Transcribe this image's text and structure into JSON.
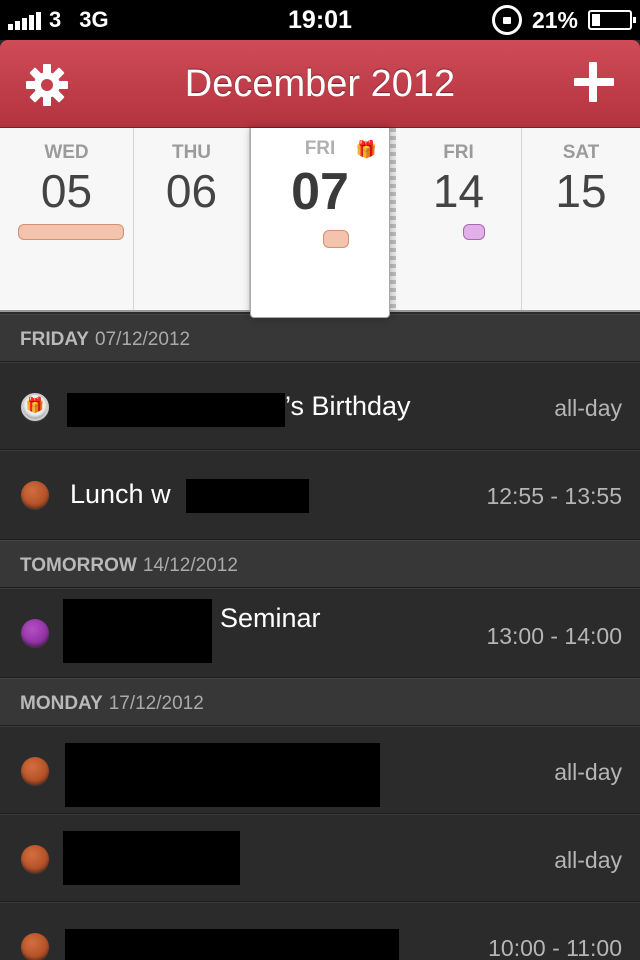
{
  "status_bar": {
    "carrier": "3",
    "network": "3G",
    "time": "19:01",
    "battery": "21%"
  },
  "header": {
    "title": "December 2012"
  },
  "icons": {
    "settings": "gear-icon",
    "add": "plus-icon",
    "birthday": "gift-icon"
  },
  "colors": {
    "header_red": "#c23f4b",
    "orange_calendar": "#b84e23",
    "purple_calendar": "#9a33ac",
    "orange_pill": "#f4c3ad",
    "purple_pill": "#e2b0e8"
  },
  "week": {
    "days": [
      {
        "name": "WED",
        "num": "05"
      },
      {
        "name": "THU",
        "num": "06"
      },
      {
        "name": "FRI",
        "num": "07",
        "selected": true
      },
      {
        "name": "FRI",
        "num": "14"
      },
      {
        "name": "SAT",
        "num": "15"
      }
    ],
    "gift_glyph": "🎁"
  },
  "sections": [
    {
      "day": "FRIDAY",
      "date": "07/12/2012",
      "events": [
        {
          "title": "’s Birthday",
          "time": "all-day",
          "calendar": "birthday",
          "glyph": "🎁"
        },
        {
          "title": "Lunch w",
          "time": "12:55 - 13:55",
          "calendar": "orange"
        }
      ]
    },
    {
      "day": "TOMORROW",
      "date": "14/12/2012",
      "events": [
        {
          "title": "Seminar",
          "time": "13:00 - 14:00",
          "calendar": "purple"
        }
      ]
    },
    {
      "day": "MONDAY",
      "date": "17/12/2012",
      "events": [
        {
          "title": "",
          "time": "all-day",
          "calendar": "orange"
        },
        {
          "title": "",
          "time": "all-day",
          "calendar": "orange"
        },
        {
          "title": "",
          "time": "10:00 - 11:00",
          "calendar": "orange"
        }
      ]
    }
  ]
}
